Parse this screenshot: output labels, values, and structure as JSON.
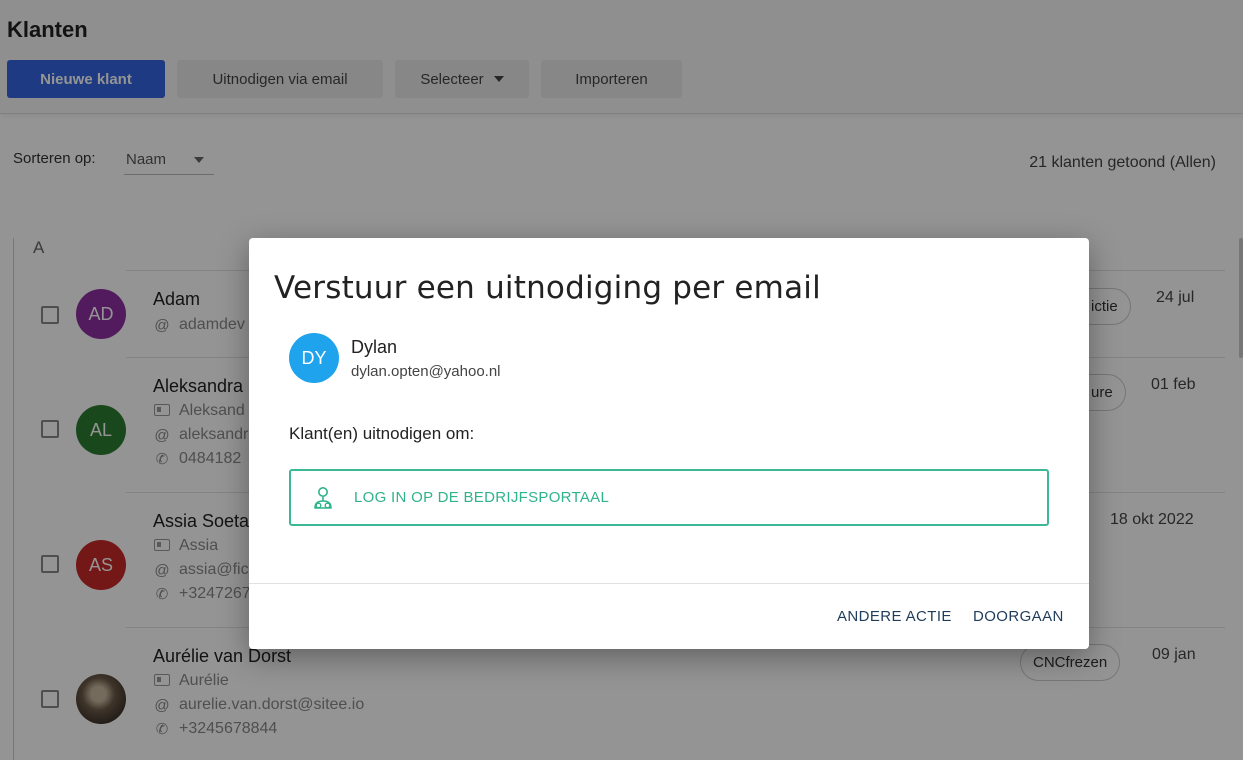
{
  "header": {
    "title": "Klanten",
    "new_client": "Nieuwe klant",
    "invite_email": "Uitnodigen via email",
    "select": "Selecteer",
    "import": "Importeren"
  },
  "sort": {
    "label": "Sorteren op:",
    "value": "Naam"
  },
  "count_text": "21 klanten getoond (Allen)",
  "group_letter": "A",
  "clients": [
    {
      "initials": "AD",
      "color": "#8e2fa3",
      "name": "Adam",
      "email": "adamdev",
      "tag": "ictie",
      "date": "24 jul"
    },
    {
      "initials": "AL",
      "color": "#2e7d32",
      "name": "Aleksandra",
      "contact": "Aleksand",
      "email": "aleksandr",
      "phone": "0484182",
      "tag": "ure",
      "date": "01 feb"
    },
    {
      "initials": "AS",
      "color": "#c62828",
      "name": "Assia Soeta",
      "contact": "Assia",
      "email": "assia@fic",
      "phone": "+3247267",
      "date": "18 okt 2022"
    },
    {
      "initials": "",
      "name": "Aurélie van Dorst",
      "contact": "Aurélie",
      "email": "aurelie.van.dorst@sitee.io",
      "phone": "+3245678844",
      "tag": "CNCfrezen",
      "date": "09 jan"
    }
  ],
  "modal": {
    "title": "Verstuur een uitnodiging per email",
    "client_initials": "DY",
    "client_name": "Dylan",
    "client_email": "dylan.opten@yahoo.nl",
    "invite_label": "Klant(en) uitnodigen om:",
    "option_label": "LOG IN OP DE BEDRIJFSPORTAAL",
    "other_action": "ANDERE ACTIE",
    "continue": "DOORGAAN"
  },
  "colors": {
    "primary": "#3264e0",
    "accent_green": "#2fb38b",
    "avatar_blue": "#1fa3ec"
  },
  "icons": {
    "email": "at-icon",
    "phone": "phone-icon",
    "contact": "id-card-icon",
    "portal": "user-group-icon"
  }
}
